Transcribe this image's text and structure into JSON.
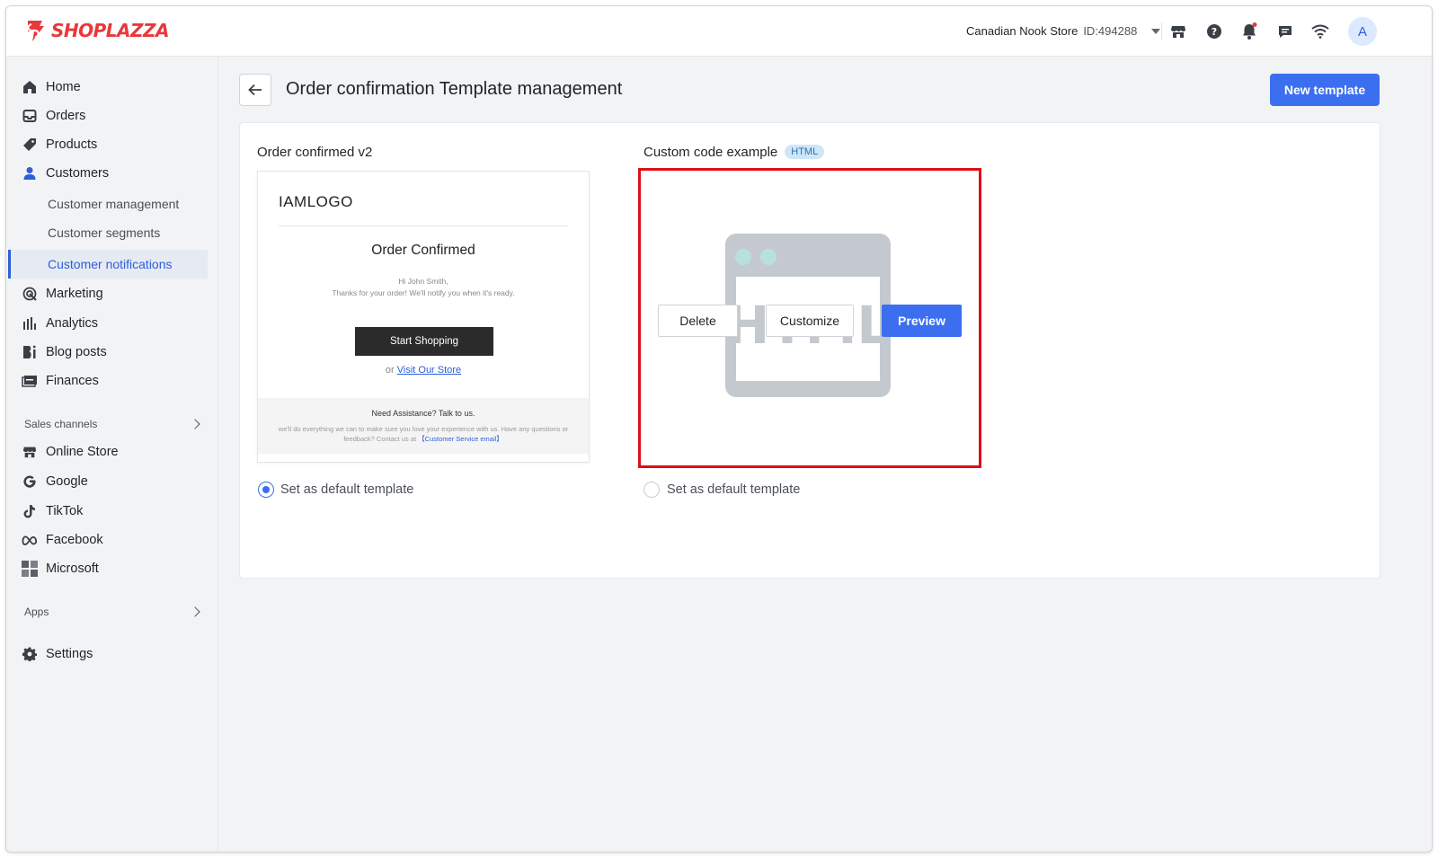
{
  "brand": {
    "name": "SHOPLAZZA",
    "color": "#e8383d"
  },
  "store": {
    "name": "Canadian Nook Store",
    "id": "ID:494288"
  },
  "topbar": {
    "icons": [
      "store-icon",
      "help-icon",
      "bell-icon",
      "chat-icon",
      "wifi-icon"
    ],
    "avatar_letter": "A"
  },
  "sidebar": {
    "items": [
      {
        "label": "Home",
        "icon": "home-icon"
      },
      {
        "label": "Orders",
        "icon": "orders-icon"
      },
      {
        "label": "Products",
        "icon": "tag-icon"
      },
      {
        "label": "Customers",
        "icon": "person-icon"
      }
    ],
    "customer_sub": [
      "Customer management",
      "Customer segments",
      "Customer notifications"
    ],
    "items2": [
      {
        "label": "Marketing",
        "icon": "marketing-icon"
      },
      {
        "label": "Analytics",
        "icon": "analytics-icon"
      },
      {
        "label": "Blog posts",
        "icon": "blog-icon"
      },
      {
        "label": "Finances",
        "icon": "finances-icon"
      }
    ],
    "sales_channels_label": "Sales channels",
    "channels": [
      {
        "label": "Online Store",
        "icon": "store-icon"
      },
      {
        "label": "Google",
        "icon": "google-icon"
      },
      {
        "label": "TikTok",
        "icon": "tiktok-icon"
      },
      {
        "label": "Facebook",
        "icon": "meta-icon"
      },
      {
        "label": "Microsoft",
        "icon": "microsoft-icon"
      }
    ],
    "apps_label": "Apps",
    "settings_label": "Settings"
  },
  "page": {
    "title": "Order confirmation Template management",
    "new_template_label": "New template"
  },
  "templates": [
    {
      "name": "Order confirmed v2",
      "default_label": "Set as default template",
      "is_default": true,
      "preview": {
        "logo": "IAMLOGO",
        "heading": "Order Confirmed",
        "greeting": "Hi John Smith,",
        "message": "Thanks for your order! We'll notify you when it's ready.",
        "button": "Start Shopping",
        "or_text": "or",
        "link": "Visit Our Store",
        "footer_heading": "Need Assistance? Talk to us.",
        "footer_text": "we'll do everything we can to make sure you love your experience with us. Have any questions or feedback? Contact us at",
        "footer_link": "【Customer Service email】"
      }
    },
    {
      "name": "Custom code example",
      "badge": "HTML",
      "default_label": "Set as default template",
      "is_default": false,
      "illustration_text": "HTML",
      "actions": {
        "delete": "Delete",
        "customize": "Customize",
        "preview": "Preview"
      }
    }
  ],
  "colors": {
    "accent": "#3c6ef0",
    "highlight": "#dd0f17"
  }
}
